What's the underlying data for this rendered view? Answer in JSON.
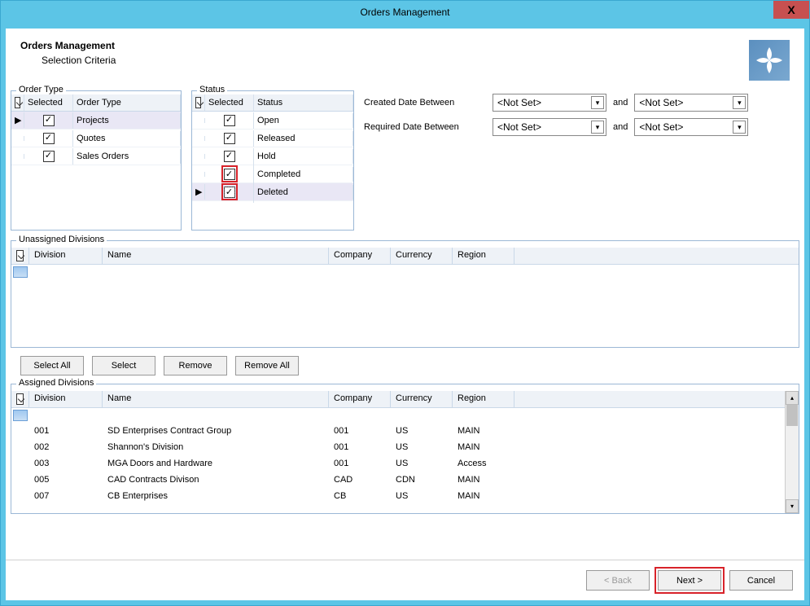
{
  "window": {
    "title": "Orders Management"
  },
  "header": {
    "title": "Orders Management",
    "subtitle": "Selection Criteria"
  },
  "orderType": {
    "legend": "Order Type",
    "columns": {
      "selected": "Selected",
      "type": "Order Type"
    },
    "rows": [
      {
        "label": "Projects",
        "checked": true,
        "current": true
      },
      {
        "label": "Quotes",
        "checked": true,
        "current": false
      },
      {
        "label": "Sales Orders",
        "checked": true,
        "current": false
      }
    ]
  },
  "status": {
    "legend": "Status",
    "columns": {
      "selected": "Selected",
      "status": "Status"
    },
    "rows": [
      {
        "label": "Open",
        "checked": true,
        "current": false,
        "hl": false
      },
      {
        "label": "Released",
        "checked": true,
        "current": false,
        "hl": false
      },
      {
        "label": "Hold",
        "checked": true,
        "current": false,
        "hl": false
      },
      {
        "label": "Completed",
        "checked": true,
        "current": false,
        "hl": true
      },
      {
        "label": "Deleted",
        "checked": true,
        "current": true,
        "hl": true
      }
    ]
  },
  "dates": {
    "created": {
      "label": "Created Date Between",
      "from": "<Not Set>",
      "and": "and",
      "to": "<Not Set>"
    },
    "required": {
      "label": "Required Date Between",
      "from": "<Not Set>",
      "and": "and",
      "to": "<Not Set>"
    }
  },
  "unassigned": {
    "legend": "Unassigned Divisions",
    "columns": {
      "division": "Division",
      "name": "Name",
      "company": "Company",
      "currency": "Currency",
      "region": "Region"
    }
  },
  "buttons": {
    "selectAll": "Select All",
    "select": "Select",
    "remove": "Remove",
    "removeAll": "Remove All"
  },
  "assigned": {
    "legend": "Assigned Divisions",
    "columns": {
      "division": "Division",
      "name": "Name",
      "company": "Company",
      "currency": "Currency",
      "region": "Region"
    },
    "rows": [
      {
        "division": "001",
        "name": "SD Enterprises Contract Group",
        "company": "001",
        "currency": "US",
        "region": "MAIN"
      },
      {
        "division": "002",
        "name": "Shannon's Division",
        "company": "001",
        "currency": "US",
        "region": "MAIN"
      },
      {
        "division": "003",
        "name": "MGA Doors and Hardware",
        "company": "001",
        "currency": "US",
        "region": "Access"
      },
      {
        "division": "005",
        "name": "CAD Contracts Divison",
        "company": "CAD",
        "currency": "CDN",
        "region": "MAIN"
      },
      {
        "division": "007",
        "name": "CB Enterprises",
        "company": "CB",
        "currency": "US",
        "region": "MAIN"
      }
    ]
  },
  "footer": {
    "back": "< Back",
    "next": "Next >",
    "cancel": "Cancel"
  }
}
